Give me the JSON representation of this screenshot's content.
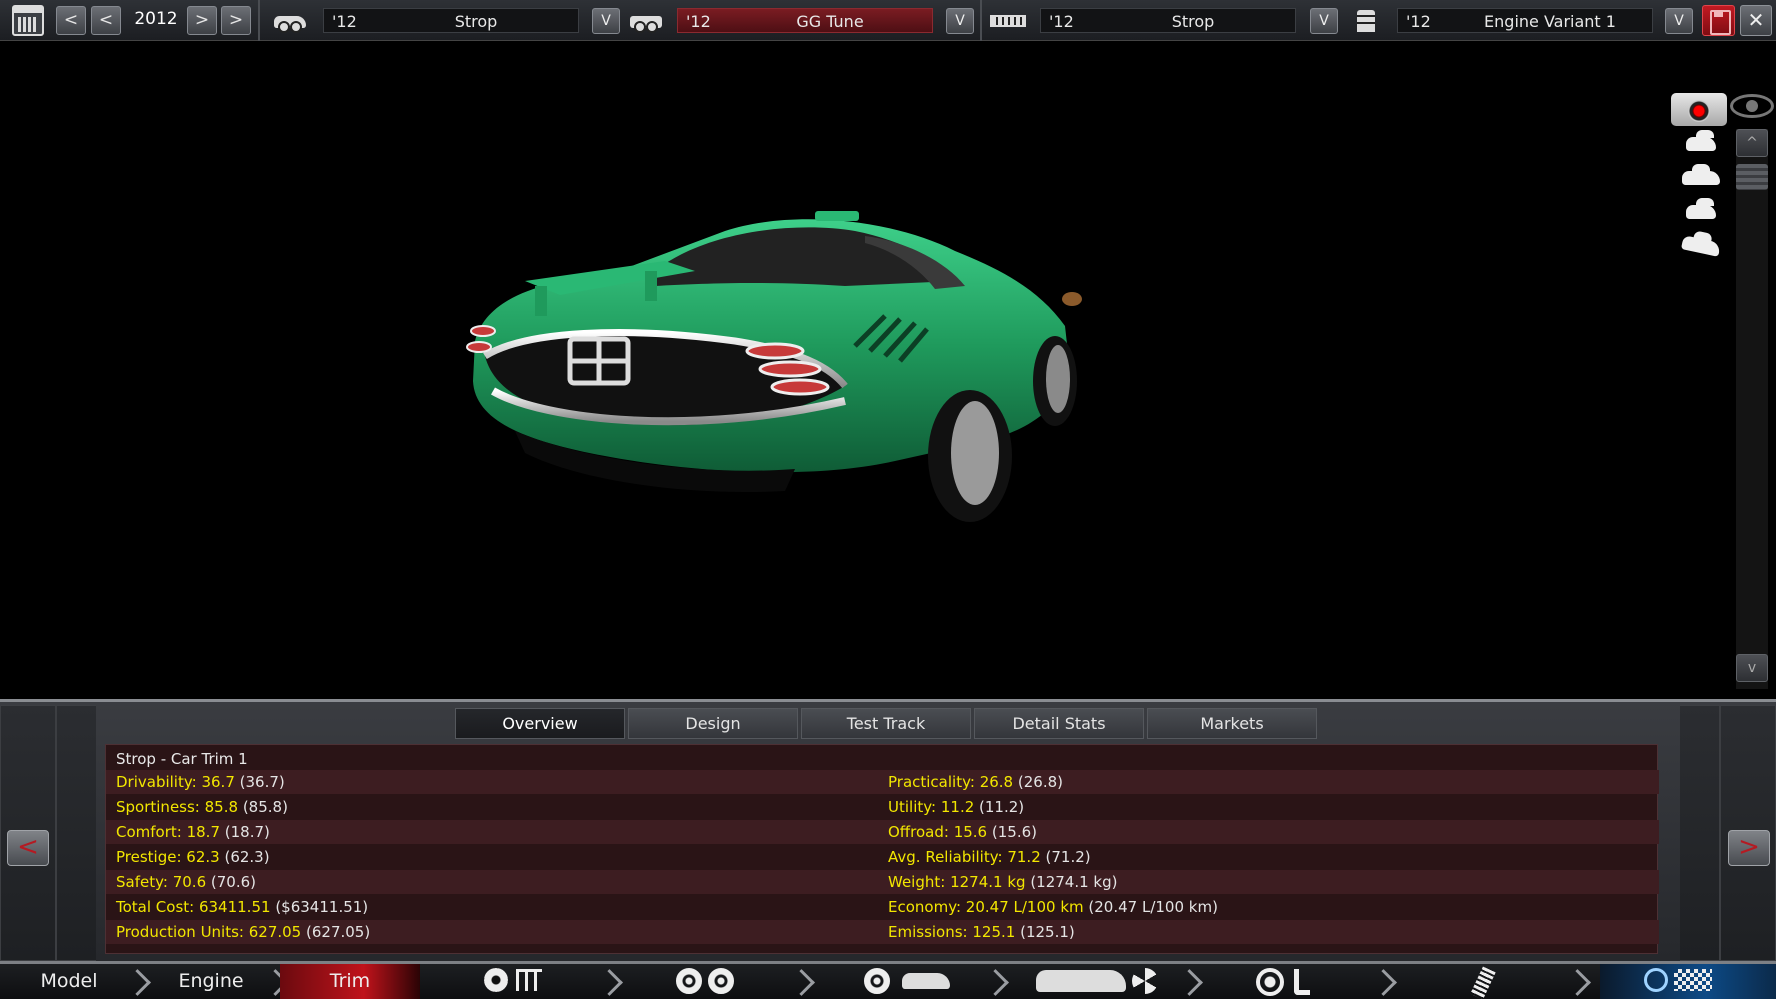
{
  "topbar": {
    "year": "2012",
    "nav_prev_label": "<",
    "nav_next_label": ">",
    "selectors": [
      {
        "year": "'12",
        "name": "Strop",
        "icon": "car-model-icon",
        "style": "dark"
      },
      {
        "year": "'12",
        "name": "GG Tune",
        "icon": "car-trim-icon",
        "style": "red"
      },
      {
        "year": "'12",
        "name": "Strop",
        "icon": "engine-block-icon",
        "style": "dark"
      },
      {
        "year": "'12",
        "name": "Engine Variant 1",
        "icon": "piston-icon",
        "style": "dark"
      }
    ],
    "dropdown_label": "V",
    "close_label": "✕"
  },
  "viewport": {
    "car_color": "#1f9a5c",
    "camera_icon": "camera-icon",
    "eye_icon": "eye-icon",
    "view_buttons": [
      "front-view-icon",
      "side-view-icon",
      "rear-view-icon",
      "perspective-view-icon"
    ],
    "scroll_up_label": "^",
    "scroll_down_label": "v"
  },
  "panel": {
    "tabs": [
      "Overview",
      "Design",
      "Test Track",
      "Detail Stats",
      "Markets"
    ],
    "active_tab": "Overview",
    "prev_label": "<",
    "next_label": ">",
    "title": "Strop - Car Trim 1",
    "stats_left": [
      {
        "key": "Drivability: 36.7",
        "paren": "(36.7)"
      },
      {
        "key": "Sportiness: 85.8",
        "paren": "(85.8)"
      },
      {
        "key": "Comfort: 18.7",
        "paren": "(18.7)"
      },
      {
        "key": "Prestige: 62.3",
        "paren": "(62.3)"
      },
      {
        "key": "Safety: 70.6",
        "paren": "(70.6)"
      },
      {
        "key": "Total Cost: 63411.51",
        "paren": "($63411.51)"
      },
      {
        "key": "Production Units: 627.05",
        "paren": "(627.05)"
      }
    ],
    "stats_right": [
      {
        "key": "Practicality: 26.8",
        "paren": "(26.8)"
      },
      {
        "key": "Utility: 11.2",
        "paren": "(11.2)"
      },
      {
        "key": "Offroad: 15.6",
        "paren": "(15.6)"
      },
      {
        "key": "Avg. Reliability: 71.2",
        "paren": "(71.2)"
      },
      {
        "key": "Weight: 1274.1 kg",
        "paren": "(1274.1 kg)"
      },
      {
        "key": "Economy: 20.47 L/100 km",
        "paren": "(20.47 L/100 km)"
      },
      {
        "key": "Emissions: 125.1",
        "paren": "(125.1)"
      }
    ],
    "key_color": "#f2e600"
  },
  "bottomnav": {
    "items": [
      "Model",
      "Engine",
      "Trim"
    ],
    "active_item": "Trim",
    "icon_groups": [
      [
        "gear-icon",
        "gearbox-icon"
      ],
      [
        "wheel-icon",
        "wheel-icon"
      ],
      [
        "wheel-icon",
        "car-body-icon"
      ],
      [
        "car-body-icon",
        "fan-icon"
      ],
      [
        "steering-wheel-icon",
        "seat-icon"
      ],
      [
        "suspension-icon"
      ],
      [
        "gauge-icon",
        "checkered-flag-icon"
      ]
    ]
  }
}
